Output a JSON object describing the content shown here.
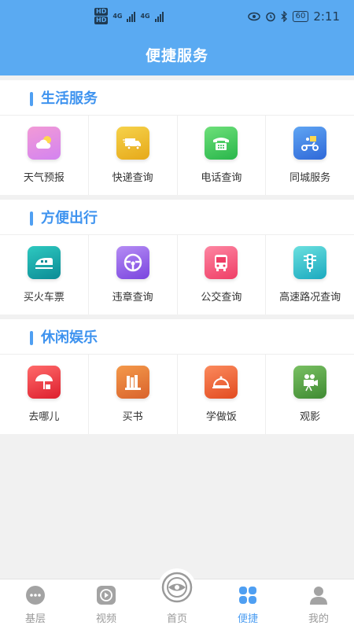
{
  "status_bar": {
    "hd_labels": [
      "HD",
      "HD"
    ],
    "network_1": "4G",
    "network_2": "4G",
    "battery": "60",
    "time": "2:11"
  },
  "header": {
    "title": "便捷服务"
  },
  "sections": [
    {
      "title": "生活服务",
      "items": [
        {
          "label": "天气预报",
          "icon": "weather-icon",
          "colors": [
            "#f29ad6",
            "#d383f0"
          ]
        },
        {
          "label": "快递查询",
          "icon": "delivery-truck-icon",
          "colors": [
            "#f6d24a",
            "#e6a91a"
          ]
        },
        {
          "label": "电话查询",
          "icon": "telephone-icon",
          "colors": [
            "#6ee07a",
            "#29b64b"
          ]
        },
        {
          "label": "同城服务",
          "icon": "scooter-icon",
          "colors": [
            "#5fa5f3",
            "#2f68d8"
          ]
        }
      ]
    },
    {
      "title": "方便出行",
      "items": [
        {
          "label": "买火车票",
          "icon": "train-icon",
          "colors": [
            "#2ec9c0",
            "#0b8b95"
          ]
        },
        {
          "label": "违章查询",
          "icon": "steering-wheel-icon",
          "colors": [
            "#b58cf4",
            "#7a45df"
          ]
        },
        {
          "label": "公交查询",
          "icon": "bus-icon",
          "colors": [
            "#fd86a2",
            "#ef3e66"
          ]
        },
        {
          "label": "高速路况查询",
          "icon": "traffic-light-icon",
          "colors": [
            "#6be0df",
            "#1aa9bf"
          ]
        }
      ]
    },
    {
      "title": "休闲娱乐",
      "items": [
        {
          "label": "去哪儿",
          "icon": "umbrella-icon",
          "colors": [
            "#ff6a6a",
            "#dd1f2e"
          ]
        },
        {
          "label": "买书",
          "icon": "books-icon",
          "colors": [
            "#f4994a",
            "#d9632d"
          ]
        },
        {
          "label": "学做饭",
          "icon": "food-cover-icon",
          "colors": [
            "#fb8a5d",
            "#e24b20"
          ]
        },
        {
          "label": "观影",
          "icon": "movie-camera-icon",
          "colors": [
            "#79c063",
            "#3f8a32"
          ]
        }
      ]
    }
  ],
  "nav": [
    {
      "label": "基层",
      "icon": "chat-icon",
      "active": false
    },
    {
      "label": "视频",
      "icon": "play-icon",
      "active": false
    },
    {
      "label": "首页",
      "icon": "home-logo-icon",
      "active": false
    },
    {
      "label": "便捷",
      "icon": "grid-icon",
      "active": true
    },
    {
      "label": "我的",
      "icon": "user-icon",
      "active": false
    }
  ],
  "colors": {
    "accent": "#4f9ff2",
    "header_bg": "#5aaaf2",
    "page_bg": "#f1f1f1"
  }
}
